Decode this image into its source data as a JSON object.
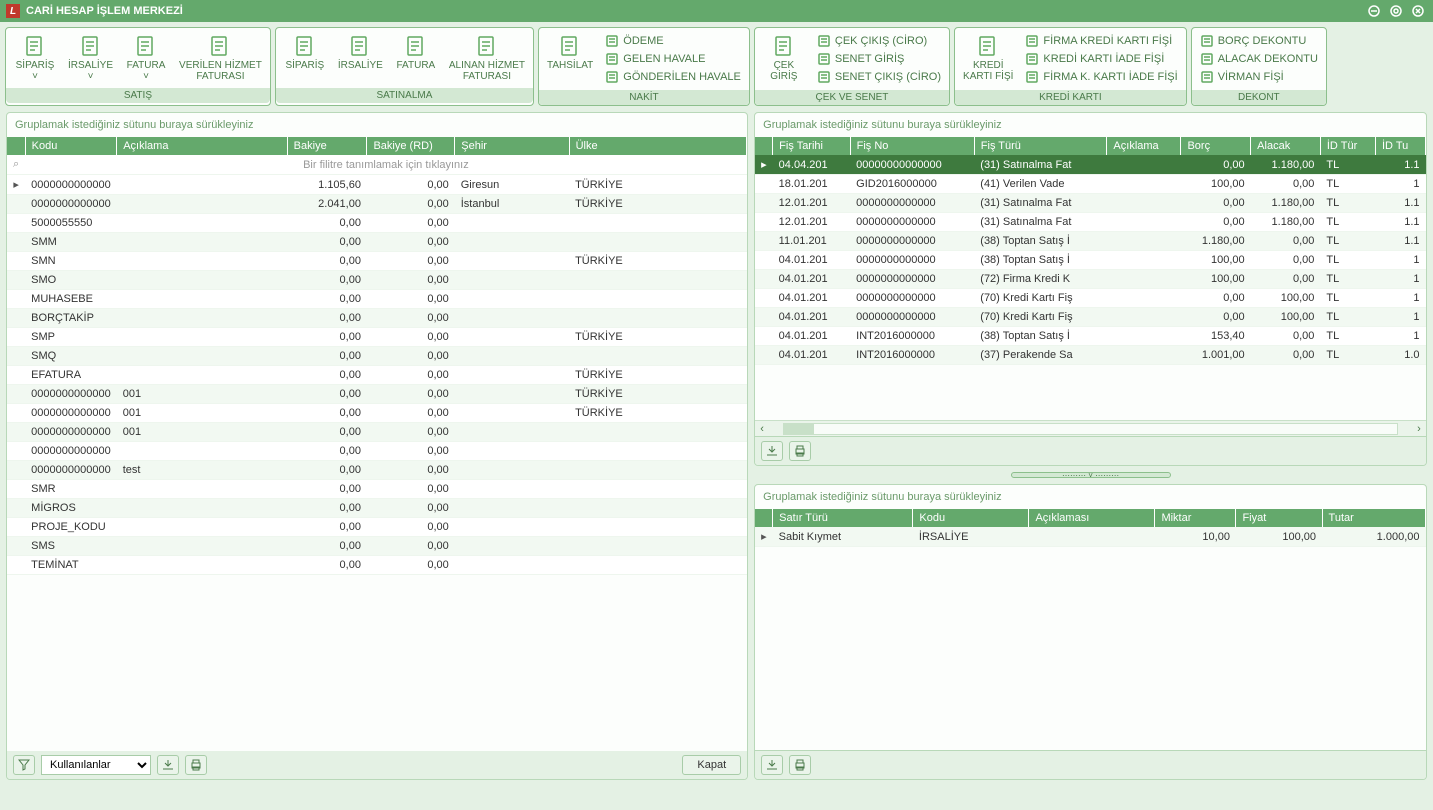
{
  "title": "CARİ HESAP İŞLEM MERKEZİ",
  "ribbon": {
    "satis": {
      "title": "SATIŞ",
      "items": [
        "SİPARİŞ",
        "İRSALİYE",
        "FATURA",
        "VERİLEN HİZMET\nFATURASI"
      ]
    },
    "satinalma": {
      "title": "SATINALMA",
      "items": [
        "SİPARİŞ",
        "İRSALİYE",
        "FATURA",
        "ALINAN HİZMET\nFATURASI"
      ]
    },
    "nakit": {
      "title": "NAKİT",
      "main": "TAHSİLAT",
      "sub": [
        "ÖDEME",
        "GELEN HAVALE",
        "GÖNDERİLEN HAVALE"
      ]
    },
    "cek": {
      "title": "ÇEK VE SENET",
      "main": "ÇEK\nGİRİŞ",
      "sub": [
        "ÇEK ÇIKIŞ (CİRO)",
        "SENET GİRİŞ",
        "SENET ÇIKIŞ (CİRO)"
      ]
    },
    "kredi": {
      "title": "KREDİ KARTI",
      "main": "KREDİ\nKARTI FİŞİ",
      "sub": [
        "FİRMA KREDİ KARTI FİŞİ",
        "KREDİ KARTI İADE FİŞİ",
        "FİRMA K. KARTI İADE FİŞİ"
      ]
    },
    "dekont": {
      "title": "DEKONT",
      "sub": [
        "BORÇ DEKONTU",
        "ALACAK DEKONTU",
        "VİRMAN FİŞİ"
      ]
    }
  },
  "grouptext": "Gruplamak istediğiniz sütunu buraya sürükleyiniz",
  "filtertext": "Bir filitre tanımlamak için tıklayınız",
  "leftcols": [
    "Kodu",
    "Açıklama",
    "Bakiye",
    "Bakiye (RD)",
    "Şehir",
    "Ülke"
  ],
  "leftrows": [
    {
      "k": "0000000000000",
      "a": "",
      "b": "1.105,60",
      "r": "0,00",
      "s": "Giresun",
      "u": "TÜRKİYE",
      "sel": true
    },
    {
      "k": "0000000000000",
      "a": "",
      "b": "2.041,00",
      "r": "0,00",
      "s": "İstanbul",
      "u": "TÜRKİYE"
    },
    {
      "k": "5000055550",
      "a": "",
      "b": "0,00",
      "r": "0,00",
      "s": "",
      "u": ""
    },
    {
      "k": "SMM",
      "a": "",
      "b": "0,00",
      "r": "0,00",
      "s": "",
      "u": ""
    },
    {
      "k": "SMN",
      "a": "",
      "b": "0,00",
      "r": "0,00",
      "s": "",
      "u": "TÜRKİYE"
    },
    {
      "k": "SMO",
      "a": "",
      "b": "0,00",
      "r": "0,00",
      "s": "",
      "u": ""
    },
    {
      "k": "MUHASEBE",
      "a": "",
      "b": "0,00",
      "r": "0,00",
      "s": "",
      "u": ""
    },
    {
      "k": "BORÇTAKİP",
      "a": "",
      "b": "0,00",
      "r": "0,00",
      "s": "",
      "u": ""
    },
    {
      "k": "SMP",
      "a": "",
      "b": "0,00",
      "r": "0,00",
      "s": "",
      "u": "TÜRKİYE"
    },
    {
      "k": "SMQ",
      "a": "",
      "b": "0,00",
      "r": "0,00",
      "s": "",
      "u": ""
    },
    {
      "k": "EFATURA",
      "a": "",
      "b": "0,00",
      "r": "0,00",
      "s": "",
      "u": "TÜRKİYE"
    },
    {
      "k": "0000000000000",
      "a": "001",
      "b": "0,00",
      "r": "0,00",
      "s": "",
      "u": "TÜRKİYE"
    },
    {
      "k": "0000000000000",
      "a": "001",
      "b": "0,00",
      "r": "0,00",
      "s": "",
      "u": "TÜRKİYE"
    },
    {
      "k": "0000000000000",
      "a": "001",
      "b": "0,00",
      "r": "0,00",
      "s": "",
      "u": ""
    },
    {
      "k": "0000000000000",
      "a": "",
      "b": "0,00",
      "r": "0,00",
      "s": "",
      "u": ""
    },
    {
      "k": "0000000000000",
      "a": "test",
      "b": "0,00",
      "r": "0,00",
      "s": "",
      "u": ""
    },
    {
      "k": "SMR",
      "a": "",
      "b": "0,00",
      "r": "0,00",
      "s": "",
      "u": ""
    },
    {
      "k": "MİGROS",
      "a": "",
      "b": "0,00",
      "r": "0,00",
      "s": "",
      "u": ""
    },
    {
      "k": "PROJE_KODU",
      "a": "",
      "b": "0,00",
      "r": "0,00",
      "s": "",
      "u": ""
    },
    {
      "k": "SMS",
      "a": "",
      "b": "0,00",
      "r": "0,00",
      "s": "",
      "u": ""
    },
    {
      "k": "TEMİNAT",
      "a": "",
      "b": "0,00",
      "r": "0,00",
      "s": "",
      "u": ""
    }
  ],
  "rightcols": [
    "Fiş Tarihi",
    "Fiş No",
    "Fiş Türü",
    "Açıklama",
    "Borç",
    "Alacak",
    "İD Tür",
    "İD Tu"
  ],
  "rightrows": [
    {
      "t": "04.04.201",
      "n": "00000000000000",
      "f": "(31) Satınalma Fat",
      "a": "",
      "b": "0,00",
      "al": "1.180,00",
      "d": "TL",
      "u": "1.1",
      "sel": true
    },
    {
      "t": "18.01.201",
      "n": "GID2016000000",
      "f": "(41) Verilen Vade",
      "a": "",
      "b": "100,00",
      "al": "0,00",
      "d": "TL",
      "u": "1"
    },
    {
      "t": "12.01.201",
      "n": "0000000000000",
      "f": "(31) Satınalma Fat",
      "a": "",
      "b": "0,00",
      "al": "1.180,00",
      "d": "TL",
      "u": "1.1"
    },
    {
      "t": "12.01.201",
      "n": "0000000000000",
      "f": "(31) Satınalma Fat",
      "a": "",
      "b": "0,00",
      "al": "1.180,00",
      "d": "TL",
      "u": "1.1"
    },
    {
      "t": "11.01.201",
      "n": "0000000000000",
      "f": "(38) Toptan Satış İ",
      "a": "",
      "b": "1.180,00",
      "al": "0,00",
      "d": "TL",
      "u": "1.1"
    },
    {
      "t": "04.01.201",
      "n": "0000000000000",
      "f": "(38) Toptan Satış İ",
      "a": "",
      "b": "100,00",
      "al": "0,00",
      "d": "TL",
      "u": "1"
    },
    {
      "t": "04.01.201",
      "n": "0000000000000",
      "f": "(72) Firma Kredi K",
      "a": "",
      "b": "100,00",
      "al": "0,00",
      "d": "TL",
      "u": "1"
    },
    {
      "t": "04.01.201",
      "n": "0000000000000",
      "f": "(70) Kredi Kartı Fiş",
      "a": "",
      "b": "0,00",
      "al": "100,00",
      "d": "TL",
      "u": "1"
    },
    {
      "t": "04.01.201",
      "n": "0000000000000",
      "f": "(70) Kredi Kartı Fiş",
      "a": "",
      "b": "0,00",
      "al": "100,00",
      "d": "TL",
      "u": "1"
    },
    {
      "t": "04.01.201",
      "n": "INT2016000000",
      "f": "(38) Toptan Satış İ",
      "a": "",
      "b": "153,40",
      "al": "0,00",
      "d": "TL",
      "u": "1"
    },
    {
      "t": "04.01.201",
      "n": "INT2016000000",
      "f": "(37) Perakende Sa",
      "a": "",
      "b": "1.001,00",
      "al": "0,00",
      "d": "TL",
      "u": "1.0"
    }
  ],
  "detailcols": [
    "Satır Türü",
    "Kodu",
    "Açıklaması",
    "Miktar",
    "Fiyat",
    "Tutar"
  ],
  "detailrows": [
    {
      "s": "Sabit Kıymet",
      "k": "İRSALİYE",
      "a": "",
      "m": "10,00",
      "f": "100,00",
      "t": "1.000,00"
    }
  ],
  "footer": {
    "combo": "Kullanılanlar",
    "close": "Kapat"
  }
}
